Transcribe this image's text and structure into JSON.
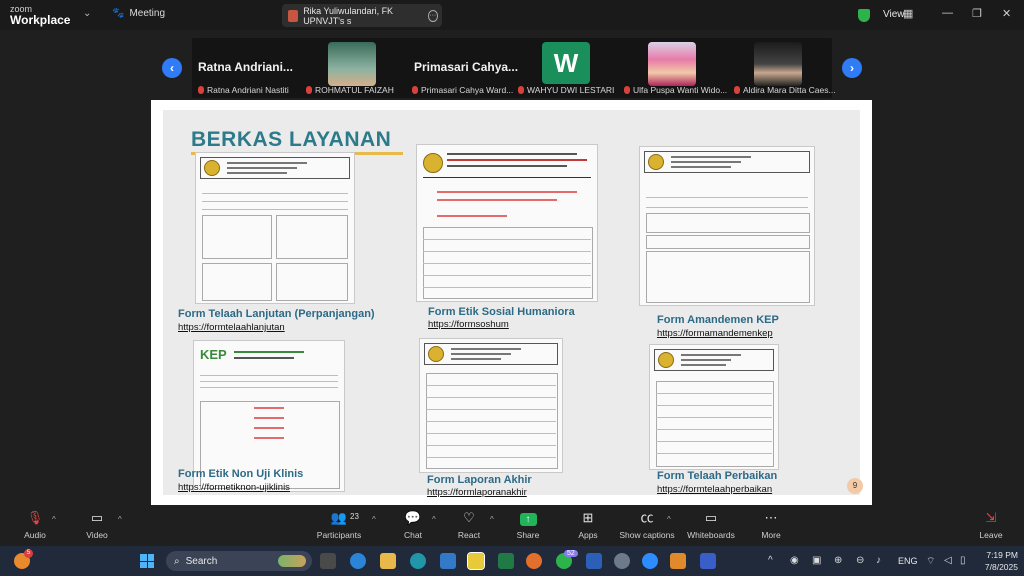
{
  "titlebar": {
    "brand_top": "zoom",
    "brand_bottom": "Workplace",
    "meeting_tab": "Meeting",
    "share_tab": "Rika Yuliwulandari, FK UPNVJT's s",
    "view": "View"
  },
  "participants": {
    "tiles": [
      {
        "name": "Ratna  Andriani...",
        "label": "Ratna Andriani Nastiti"
      },
      {
        "name": "",
        "label": "ROHMATUL FAIZAH"
      },
      {
        "name": "Primasari  Cahya...",
        "label": "Primasari Cahya Ward..."
      },
      {
        "name": "W",
        "label": "WAHYU DWI LESTARI"
      },
      {
        "name": "",
        "label": "Ulfa Puspa Wanti Wido..."
      },
      {
        "name": "",
        "label": "Aldira Mara Ditta Caes..."
      }
    ]
  },
  "slide": {
    "title": "BERKAS LAYANAN",
    "forms": [
      {
        "title": "Form Telaah Lanjutan (Perpanjangan)",
        "link": "https://formtelaahlanjutan"
      },
      {
        "title": "Form Etik Sosial Humaniora",
        "link": "https://formsoshum"
      },
      {
        "title": "Form Amandemen KEP",
        "link": "https://formamandemenkep"
      },
      {
        "title": "Form Etik Non Uji Klinis",
        "link": "https://formetiknon-ujiklinis"
      },
      {
        "title": "Form Laporan Akhir",
        "link": "https://formlaporanakhir"
      },
      {
        "title": "Form Telaah Perbaikan",
        "link": "https://formtelaahperbaikan"
      }
    ],
    "kep_logo_text": "KEP",
    "page_number": "9"
  },
  "toolbar": {
    "audio": "Audio",
    "video": "Video",
    "participants": "Participants",
    "participants_count": "23",
    "chat": "Chat",
    "react": "React",
    "share": "Share",
    "apps": "Apps",
    "captions": "Show captions",
    "whiteboards": "Whiteboards",
    "more": "More",
    "leave": "Leave"
  },
  "taskbar": {
    "search": "Search",
    "weather_badge": "5",
    "whatsapp_badge": "52",
    "language": "ENG",
    "time": "7:19 PM",
    "date": "7/8/2025"
  }
}
